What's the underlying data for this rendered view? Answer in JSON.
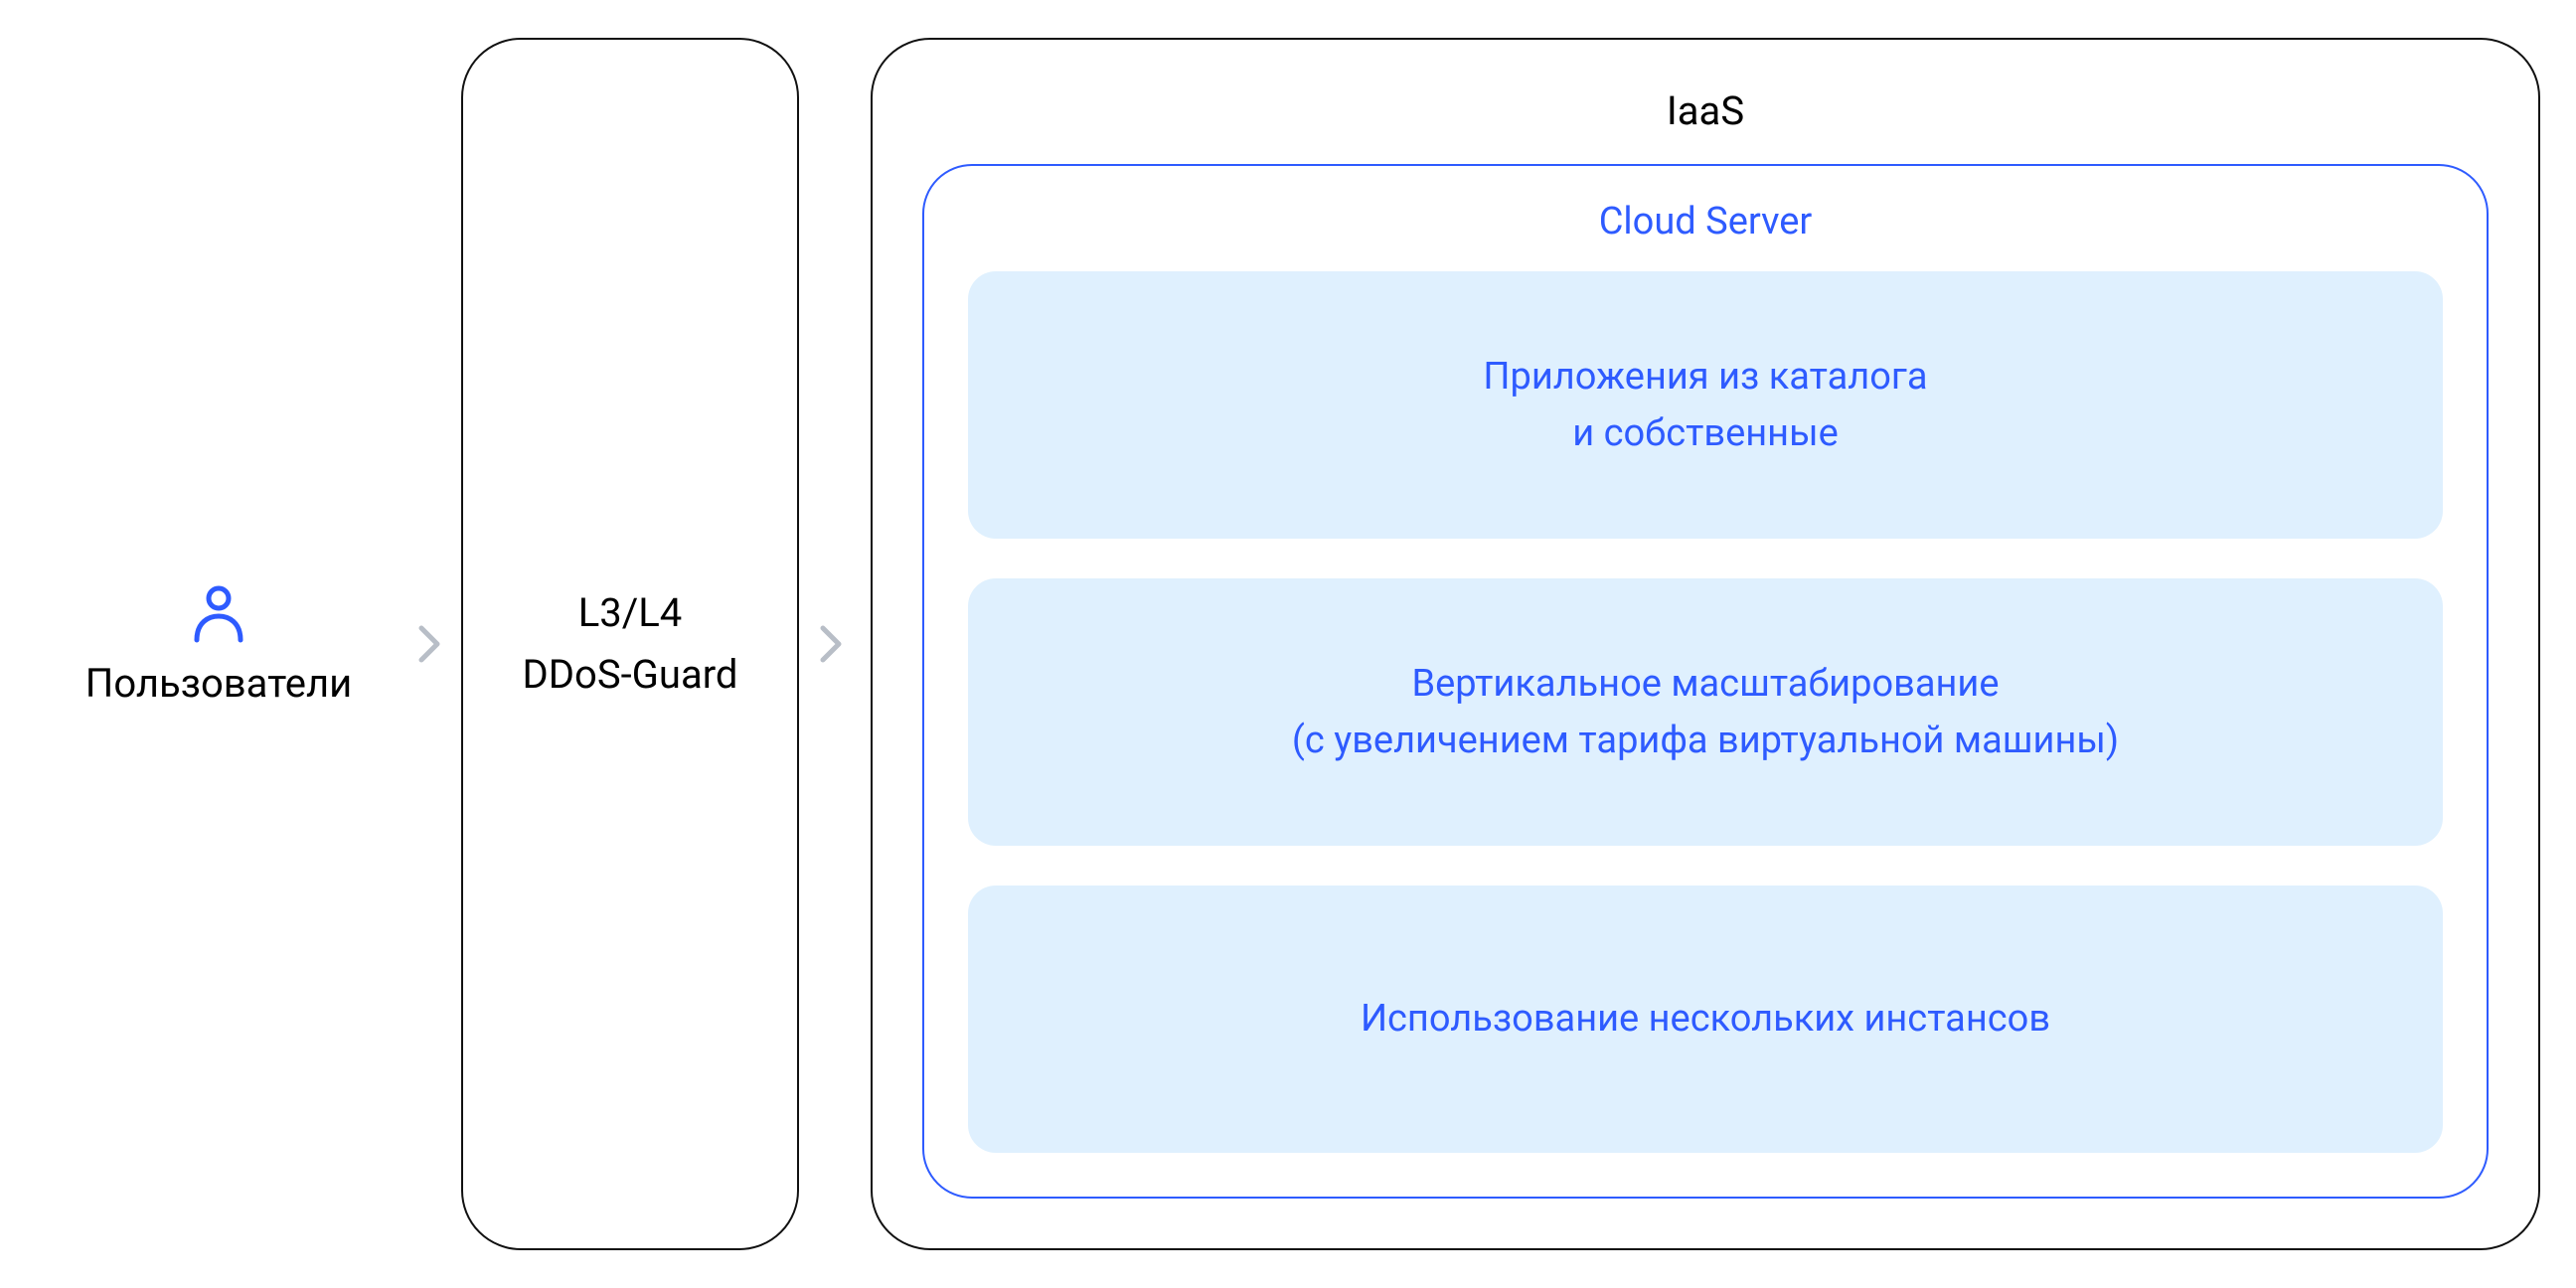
{
  "users": {
    "label": "Пользователи"
  },
  "guard": {
    "line1": "L3/L4",
    "line2": "DDoS-Guard"
  },
  "iaas": {
    "title": "IaaS",
    "cloud": {
      "title": "Cloud Server",
      "cards": [
        {
          "line1": "Приложения из каталога",
          "line2": "и собственные"
        },
        {
          "line1": "Вертикальное масштабирование",
          "line2": "(с увеличением тарифа виртуальной машины)"
        },
        {
          "line1": "Использование нескольких инстансов",
          "line2": ""
        }
      ]
    }
  }
}
